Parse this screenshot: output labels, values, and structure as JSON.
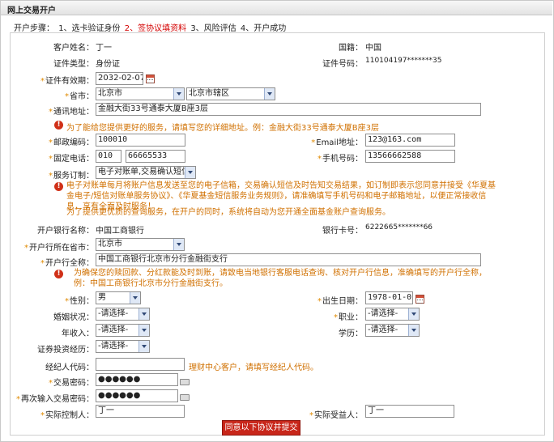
{
  "window": {
    "title": "网上交易开户"
  },
  "steps": {
    "prefix": "开户步骤：",
    "s1": "1、选卡验证身份",
    "s2": "2、签协议填资料",
    "s3": "3、风险评估",
    "s4": "4、开户成功"
  },
  "customer": {
    "name_label": "客户姓名：",
    "name": "丁一",
    "nation_label": "国籍：",
    "nation": "中国",
    "idtype_label": "证件类型：",
    "idtype": "身份证",
    "idno_label": "证件号码：",
    "idno": "110104197*******35"
  },
  "validity": {
    "label": "证件有效期：",
    "value": "2032-02-07"
  },
  "province": {
    "label": "省市：",
    "province": "北京市",
    "district": "北京市辖区"
  },
  "address": {
    "label": "通讯地址：",
    "value": "金融大街33号通泰大厦B座3层",
    "hint": "为了能给您提供更好的服务，请填写您的详细地址。例：金融大街33号通泰大厦B座3层"
  },
  "postcode": {
    "label": "邮政编码：",
    "value": "100010"
  },
  "email": {
    "label": "Email地址：",
    "value": "123@163.com"
  },
  "phone": {
    "label": "固定电话：",
    "area": "010",
    "number": "66665533"
  },
  "mobile": {
    "label": "手机号码：",
    "value": "13566662588"
  },
  "service": {
    "label": "服务订制：",
    "value": "电子对账单,交易确认短信",
    "note1": "电子对账单每月将账户信息发送至您的电子信箱，交易确认短信及时告知交易结果，如订制即表示您同意并接受《华夏基金电子/短信对账单服务协议》、《华夏基金短信服务业务规则》，请准确填写手机号码和电子邮箱地址，以便正常接收信息，享有全面及时服务！",
    "note2": "为了提供更优质的查询服务，在开户的同时，系统将自动为您开通全面基金账户查询服务。"
  },
  "bank": {
    "name_label": "开户银行名称：",
    "name": "中国工商银行",
    "card_label": "银行卡号：",
    "card": "6222665*******66",
    "region_label": "开户行所在省市：",
    "region": "北京市",
    "branch_label": "开户行全称：",
    "branch": "中国工商银行北京市分行金融街支行",
    "hint": "为确保您的赎回款、分红款能及时到账，请致电当地银行客服电话查询、核对开户行信息，准确填写的开户行全称，例：中国工商银行北京市分行金融街支行。"
  },
  "gender": {
    "label": "性别：",
    "value": "男"
  },
  "birthday": {
    "label": "出生日期：",
    "value": "1978-01-05"
  },
  "marriage": {
    "label": "婚姻状况：",
    "value": "-请选择-"
  },
  "job": {
    "label": "职业：",
    "value": "-请选择-"
  },
  "income": {
    "label": "年收入：",
    "value": "-请选择-"
  },
  "education": {
    "label": "学历：",
    "value": "-请选择-"
  },
  "experience": {
    "label": "证券投资经历：",
    "value": "-请选择-"
  },
  "agent": {
    "label": "经纪人代码：",
    "value": "",
    "hint": "理财中心客户，请填写经纪人代码。"
  },
  "password": {
    "label": "交易密码：",
    "value": "●●●●●●"
  },
  "password2": {
    "label": "再次输入交易密码：",
    "value": "●●●●●●"
  },
  "controller": {
    "label": "实际控制人：",
    "value": "丁一"
  },
  "beneficiary": {
    "label": "实际受益人：",
    "value": "丁一"
  },
  "submit": {
    "label": "同意以下协议并提交"
  }
}
